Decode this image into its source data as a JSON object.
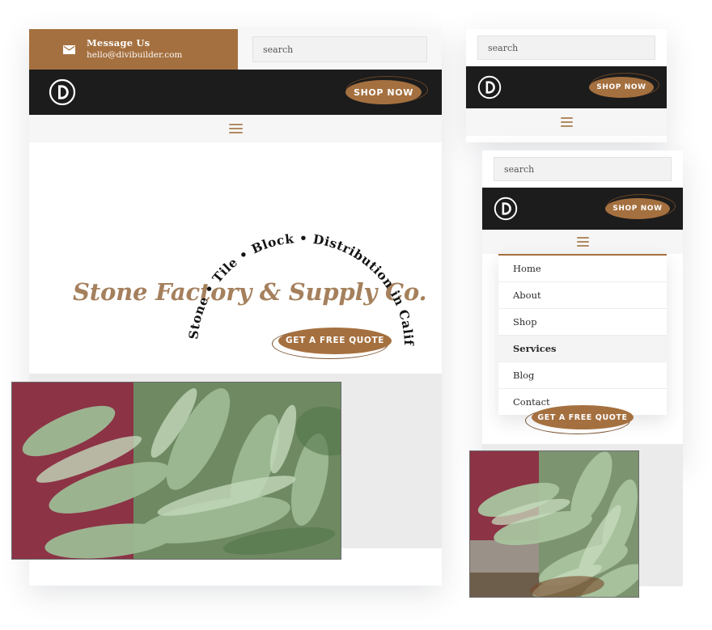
{
  "brand": {
    "logo_letter": "D",
    "accent_color": "#a5703f",
    "dark_color": "#1c1c1c",
    "headline_color": "#a5805d"
  },
  "desktop": {
    "topbar": {
      "mail_icon": "envelope-icon",
      "message_label": "Message Us",
      "email": "hello@divibuilder.com",
      "search_placeholder": "search",
      "search_value": ""
    },
    "navbar": {
      "logo_name": "divi-logo",
      "shop_button": "SHOP NOW"
    },
    "menubar": {
      "hamburger": "hamburger-icon"
    },
    "hero": {
      "arc_text": "Stone • Tile • Block • Distribution in California",
      "headline": "Stone Factory & Supply Co.",
      "cta_button": "GET A FREE QUOTE",
      "photo_alt": "green-fern-foliage-against-red-wall"
    }
  },
  "mobile_back": {
    "search_placeholder": "search",
    "shop_button": "SHOP NOW",
    "hamburger": "hamburger-icon"
  },
  "mobile_front": {
    "search_placeholder": "search",
    "shop_button": "SHOP NOW",
    "hamburger": "hamburger-icon",
    "menu_items": [
      {
        "label": "Home",
        "active": false
      },
      {
        "label": "About",
        "active": false
      },
      {
        "label": "Shop",
        "active": false
      },
      {
        "label": "Services",
        "active": true
      },
      {
        "label": "Blog",
        "active": false
      },
      {
        "label": "Contact",
        "active": false
      }
    ],
    "cta_button": "GET A FREE QUOTE",
    "photo_alt": "ferns-beside-brick-wall-and-walkway"
  }
}
